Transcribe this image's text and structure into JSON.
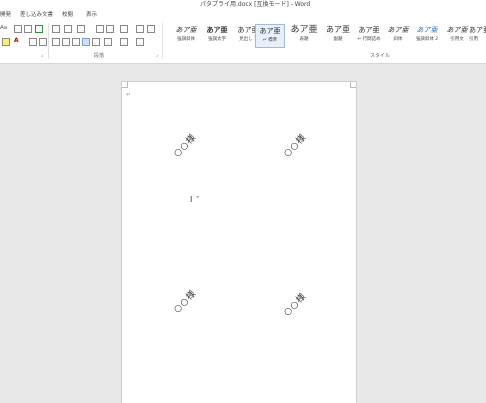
{
  "window": {
    "title": "パタプライ用.docx [互換モード] - Word"
  },
  "menu": {
    "tabs": [
      "差し込み文書",
      "校閲",
      "表示"
    ],
    "left_stub": "開発"
  },
  "ribbon": {
    "groups": {
      "paragraph_label": "段落",
      "styles_label": "スタイル"
    },
    "font_stub": "Aa",
    "styles": [
      {
        "sample": "あア亜",
        "name": "強調斜体"
      },
      {
        "sample": "あア亜",
        "name": "強調太字"
      },
      {
        "sample": "あア亜",
        "name": "見出し 1"
      },
      {
        "sample": "あア亜",
        "name": "↵ 標準"
      },
      {
        "sample": "あア亜",
        "name": "表題"
      },
      {
        "sample": "あア亜",
        "name": "副題"
      },
      {
        "sample": "あア亜",
        "name": "↵ 行間詰め"
      },
      {
        "sample": "あア亜",
        "name": "斜体"
      },
      {
        "sample": "あア亜",
        "name": "強調斜体 2"
      },
      {
        "sample": "あア亜",
        "name": "引用文"
      },
      {
        "sample": "あア亜",
        "name": "引用"
      }
    ],
    "selected_style_index": 3
  },
  "document": {
    "paragraph_mark": "↵",
    "labels": [
      "○○様",
      "○○様",
      "○○様",
      "○○様"
    ],
    "cursor_glyph": "I",
    "cursor_tag": "≡"
  },
  "colors": {
    "accent": "#2b579a",
    "font_color": "#c00000",
    "highlight": "#ffff00"
  }
}
